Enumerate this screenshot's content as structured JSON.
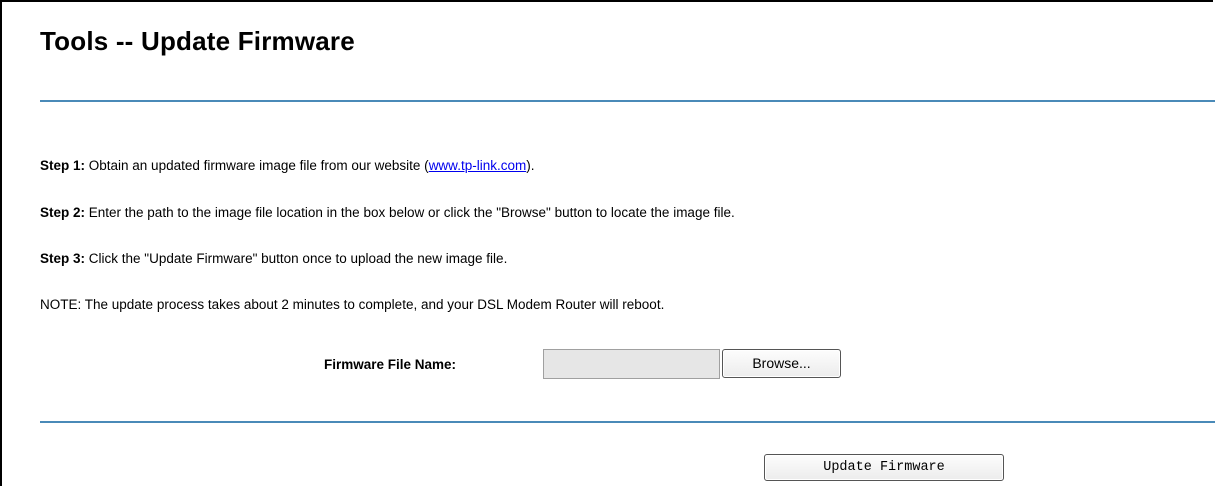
{
  "page": {
    "title": "Tools -- Update Firmware"
  },
  "steps": [
    {
      "label": "Step 1:",
      "text_before": " Obtain an updated firmware image file from our website (",
      "link": "www.tp-link.com",
      "text_after": ")."
    },
    {
      "label": "Step 2:",
      "text": " Enter the path to the image file location in the box below or click the \"Browse\" button to locate the image file."
    },
    {
      "label": "Step 3:",
      "text": " Click the \"Update Firmware\" button once to upload the new image file."
    }
  ],
  "note": "NOTE: The update process takes about 2 minutes to complete, and your DSL Modem Router will reboot.",
  "firmware": {
    "label": "Firmware File Name:",
    "value": "",
    "browse_label": "Browse..."
  },
  "actions": {
    "update_label": "Update Firmware"
  },
  "colors": {
    "rule": "#4a8ab8",
    "link": "#0000ee"
  }
}
